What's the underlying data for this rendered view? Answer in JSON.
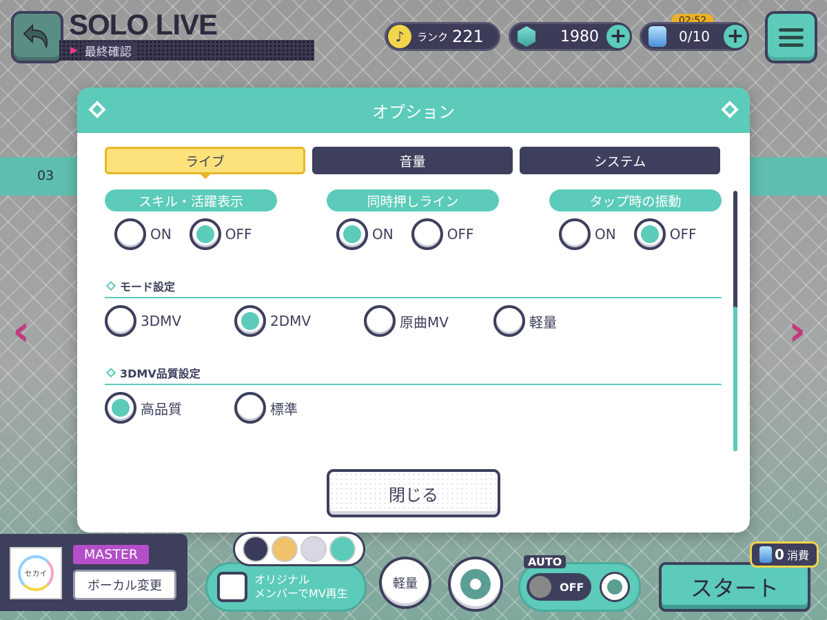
{
  "header": {
    "title": "SOLO LIVE",
    "subtitle": "最終確認",
    "rank_label": "ランク",
    "rank_value": "221",
    "gems": "1980",
    "energy_timer": "02:52",
    "energy": "0/10"
  },
  "background": {
    "row_number": "03"
  },
  "modal": {
    "title": "オプション",
    "tabs": [
      {
        "label": "ライブ",
        "active": true
      },
      {
        "label": "音量",
        "active": false
      },
      {
        "label": "システム",
        "active": false
      }
    ],
    "toggle_groups": [
      {
        "label": "スキル・活躍表示",
        "on_label": "ON",
        "off_label": "OFF",
        "selected": "OFF"
      },
      {
        "label": "同時押しライン",
        "on_label": "ON",
        "off_label": "OFF",
        "selected": "ON"
      },
      {
        "label": "タップ時の振動",
        "on_label": "ON",
        "off_label": "OFF",
        "selected": "OFF"
      }
    ],
    "mode_section": {
      "title": "モード設定",
      "options": [
        "3DMV",
        "2DMV",
        "原曲MV",
        "軽量"
      ],
      "selected": "2DMV"
    },
    "quality_section": {
      "title": "3DMV品質設定",
      "options": [
        "高品質",
        "標準"
      ],
      "selected": "高品質"
    },
    "close_label": "閉じる"
  },
  "footer": {
    "jacket_text": "セカイ",
    "difficulty": "MASTER",
    "vocal_change": "ボーカル変更",
    "mv_toggle_line1": "オリジナル",
    "mv_toggle_line2": "メンバーでMV再生",
    "light_mode": "軽量",
    "auto_label": "AUTO",
    "auto_state": "OFF",
    "start": "スタート",
    "cost_value": "0",
    "cost_label": "消費"
  },
  "colors": {
    "accent": "#5ccbb9",
    "dark": "#3d3f5c",
    "tab_active": "#fde27b",
    "difficulty": "#b44ec9"
  }
}
